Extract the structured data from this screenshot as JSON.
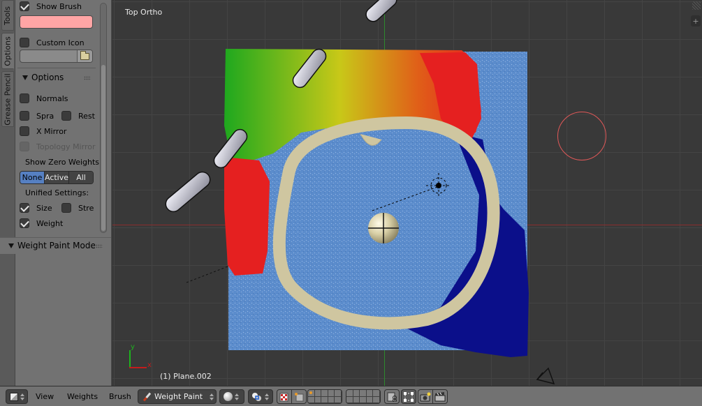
{
  "shelf": {
    "tabs": [
      {
        "label": "Tools",
        "active": false
      },
      {
        "label": "Options",
        "active": true
      },
      {
        "label": "Grease Pencil",
        "active": false
      }
    ],
    "show_brush": {
      "label": "Show Brush",
      "checked": true
    },
    "brush_color": "#ffa5a5",
    "custom_icon": {
      "label": "Custom Icon",
      "checked": false,
      "path_value": ""
    },
    "options_header": "Options",
    "options": {
      "normals": {
        "label": "Normals",
        "checked": false
      },
      "spray": {
        "label": "Spra",
        "checked": false
      },
      "restore": {
        "label": "Rest",
        "checked": false
      },
      "x_mirror": {
        "label": "X Mirror",
        "checked": false
      },
      "topology_mirror": {
        "label": "Topology Mirror",
        "checked": false,
        "enabled": false
      }
    },
    "show_zero_weights": {
      "label": "Show Zero Weights:",
      "options": [
        "None",
        "Active",
        "All"
      ],
      "selected": "None"
    },
    "unified_settings": {
      "label": "Unified Settings:",
      "size": {
        "label": "Size",
        "checked": true
      },
      "strength": {
        "label": "Stre",
        "checked": false
      },
      "weight": {
        "label": "Weight",
        "checked": true
      }
    },
    "weight_paint_mode_header": "Weight Paint Mode"
  },
  "viewport": {
    "view_name": "Top Ortho",
    "active_object": "(1) Plane.002",
    "axis_x_label": "x",
    "axis_y_label": "y",
    "add_button": "+",
    "colors": {
      "ground": "#5b8ccc",
      "bone_ring": "#cfc6a0",
      "weight_high": "#e52020",
      "weight_mid": "#e0c020",
      "weight_low_green": "#1ea81e",
      "weight_zero": "#0b0f8a",
      "brush_circle": "#e05858"
    }
  },
  "bottom_bar": {
    "editor_type_icon": "cube-icon",
    "menus": [
      "View",
      "Weights",
      "Brush"
    ],
    "mode": "Weight Paint",
    "viewport_shading_icon": "sphere-icon",
    "pivot_icon": "pivot-icon",
    "toggles": [
      "texture-paint-mask-icon",
      "vertex-select-mask-icon"
    ],
    "layers_icon": "layers-grid",
    "lock_icon": "lock-camera-icon",
    "snap_icon": "snap-icon",
    "render_icons": [
      "opengl-render-icon",
      "opengl-animation-icon"
    ]
  }
}
